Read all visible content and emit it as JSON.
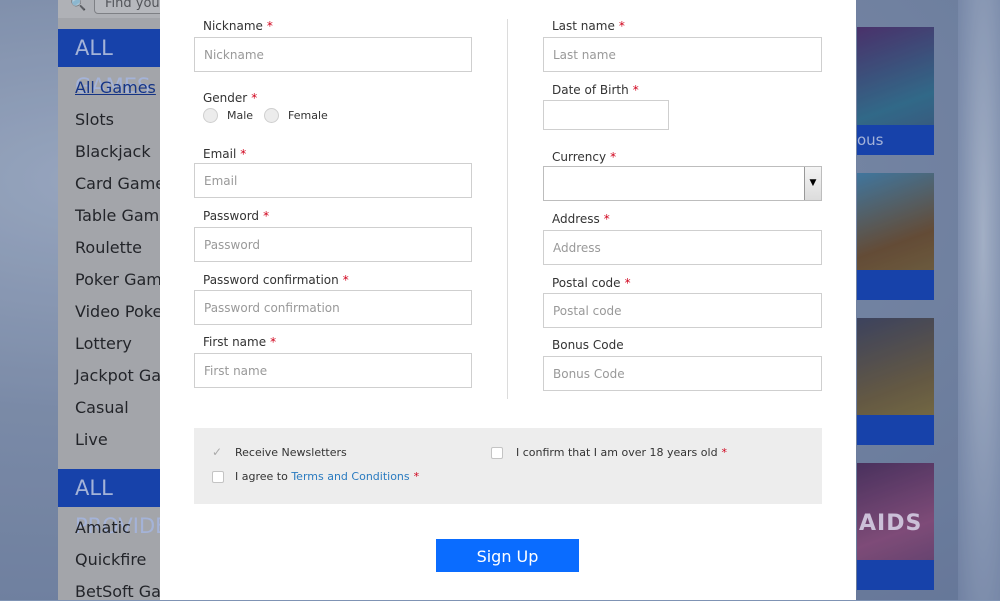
{
  "background": {
    "search": {
      "placeholder": "Find your"
    },
    "sidebar": {
      "games_heading": "ALL GAMES",
      "games": [
        "All Games",
        "Slots",
        "Blackjack",
        "Card Games",
        "Table Games",
        "Roulette",
        "Poker Games",
        "Video Poker",
        "Lottery",
        "Jackpot Games",
        "Casual",
        "Live"
      ],
      "providers_heading": "ALL PROVIDERS",
      "providers": [
        "Amatic",
        "Quickfire",
        "BetSoft Games"
      ]
    },
    "thumbnails": [
      {
        "caption": "ous"
      },
      {
        "caption": ""
      },
      {
        "caption": ""
      },
      {
        "caption": "",
        "art_text": "AIDS"
      }
    ]
  },
  "form": {
    "nickname": {
      "label": "Nickname",
      "placeholder": "Nickname"
    },
    "gender": {
      "label": "Gender",
      "options": [
        "Male",
        "Female"
      ]
    },
    "email": {
      "label": "Email",
      "placeholder": "Email"
    },
    "password": {
      "label": "Password",
      "placeholder": "Password"
    },
    "password_confirmation": {
      "label": "Password confirmation",
      "placeholder": "Password confirmation"
    },
    "first_name": {
      "label": "First name",
      "placeholder": "First name"
    },
    "last_name": {
      "label": "Last name",
      "placeholder": "Last name"
    },
    "dob": {
      "label": "Date of Birth",
      "value": ""
    },
    "currency": {
      "label": "Currency",
      "value": ""
    },
    "address": {
      "label": "Address",
      "placeholder": "Address"
    },
    "postal_code": {
      "label": "Postal code",
      "placeholder": "Postal code"
    },
    "bonus_code": {
      "label": "Bonus Code",
      "placeholder": "Bonus Code"
    },
    "required_marker": "*",
    "newsletter": {
      "label": "Receive Newsletters",
      "checked": true
    },
    "age_confirm": {
      "label": "I confirm that I am over 18 years old",
      "checked": false
    },
    "terms": {
      "prefix": "I agree to",
      "link": "Terms and Conditions",
      "checked": false
    },
    "submit": "Sign Up"
  },
  "colors": {
    "primary": "#0a6cff",
    "nav": "#0d3fb8",
    "required": "#d0021b",
    "link": "#2a7bc0"
  }
}
